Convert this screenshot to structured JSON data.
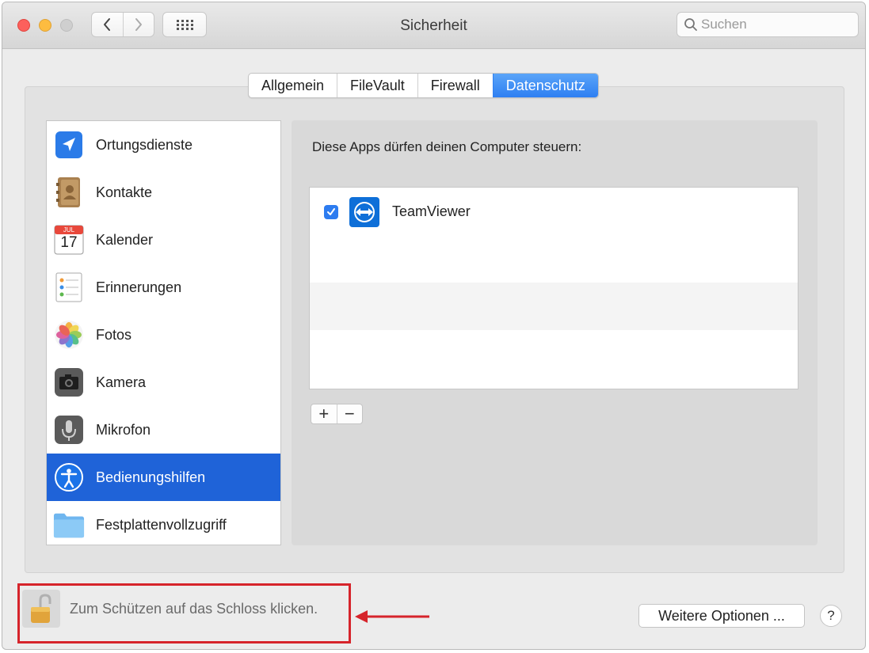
{
  "window": {
    "title": "Sicherheit"
  },
  "search": {
    "placeholder": "Suchen"
  },
  "tabs": [
    {
      "label": "Allgemein"
    },
    {
      "label": "FileVault"
    },
    {
      "label": "Firewall"
    },
    {
      "label": "Datenschutz",
      "active": true
    }
  ],
  "sidebar": {
    "items": [
      {
        "label": "Ortungsdienste",
        "icon": "location-arrow-icon"
      },
      {
        "label": "Kontakte",
        "icon": "contacts-book-icon"
      },
      {
        "label": "Kalender",
        "icon": "calendar-icon",
        "icon_month": "JUL",
        "icon_day": "17"
      },
      {
        "label": "Erinnerungen",
        "icon": "reminders-icon"
      },
      {
        "label": "Fotos",
        "icon": "photos-icon"
      },
      {
        "label": "Kamera",
        "icon": "camera-icon"
      },
      {
        "label": "Mikrofon",
        "icon": "microphone-icon"
      },
      {
        "label": "Bedienungshilfen",
        "icon": "accessibility-icon",
        "selected": true
      },
      {
        "label": "Festplattenvollzugriff",
        "icon": "folder-icon"
      }
    ]
  },
  "content": {
    "heading": "Diese Apps dürfen deinen Computer steuern:",
    "apps": [
      {
        "name": "TeamViewer",
        "checked": true,
        "icon": "teamviewer-icon"
      }
    ],
    "add_label": "+",
    "remove_label": "−"
  },
  "footer": {
    "lock_text": "Zum Schützen auf das Schloss klicken.",
    "more_options": "Weitere Optionen ...",
    "help_label": "?"
  },
  "colors": {
    "accent": "#1f63d8",
    "highlight_annotation": "#d6242b"
  }
}
